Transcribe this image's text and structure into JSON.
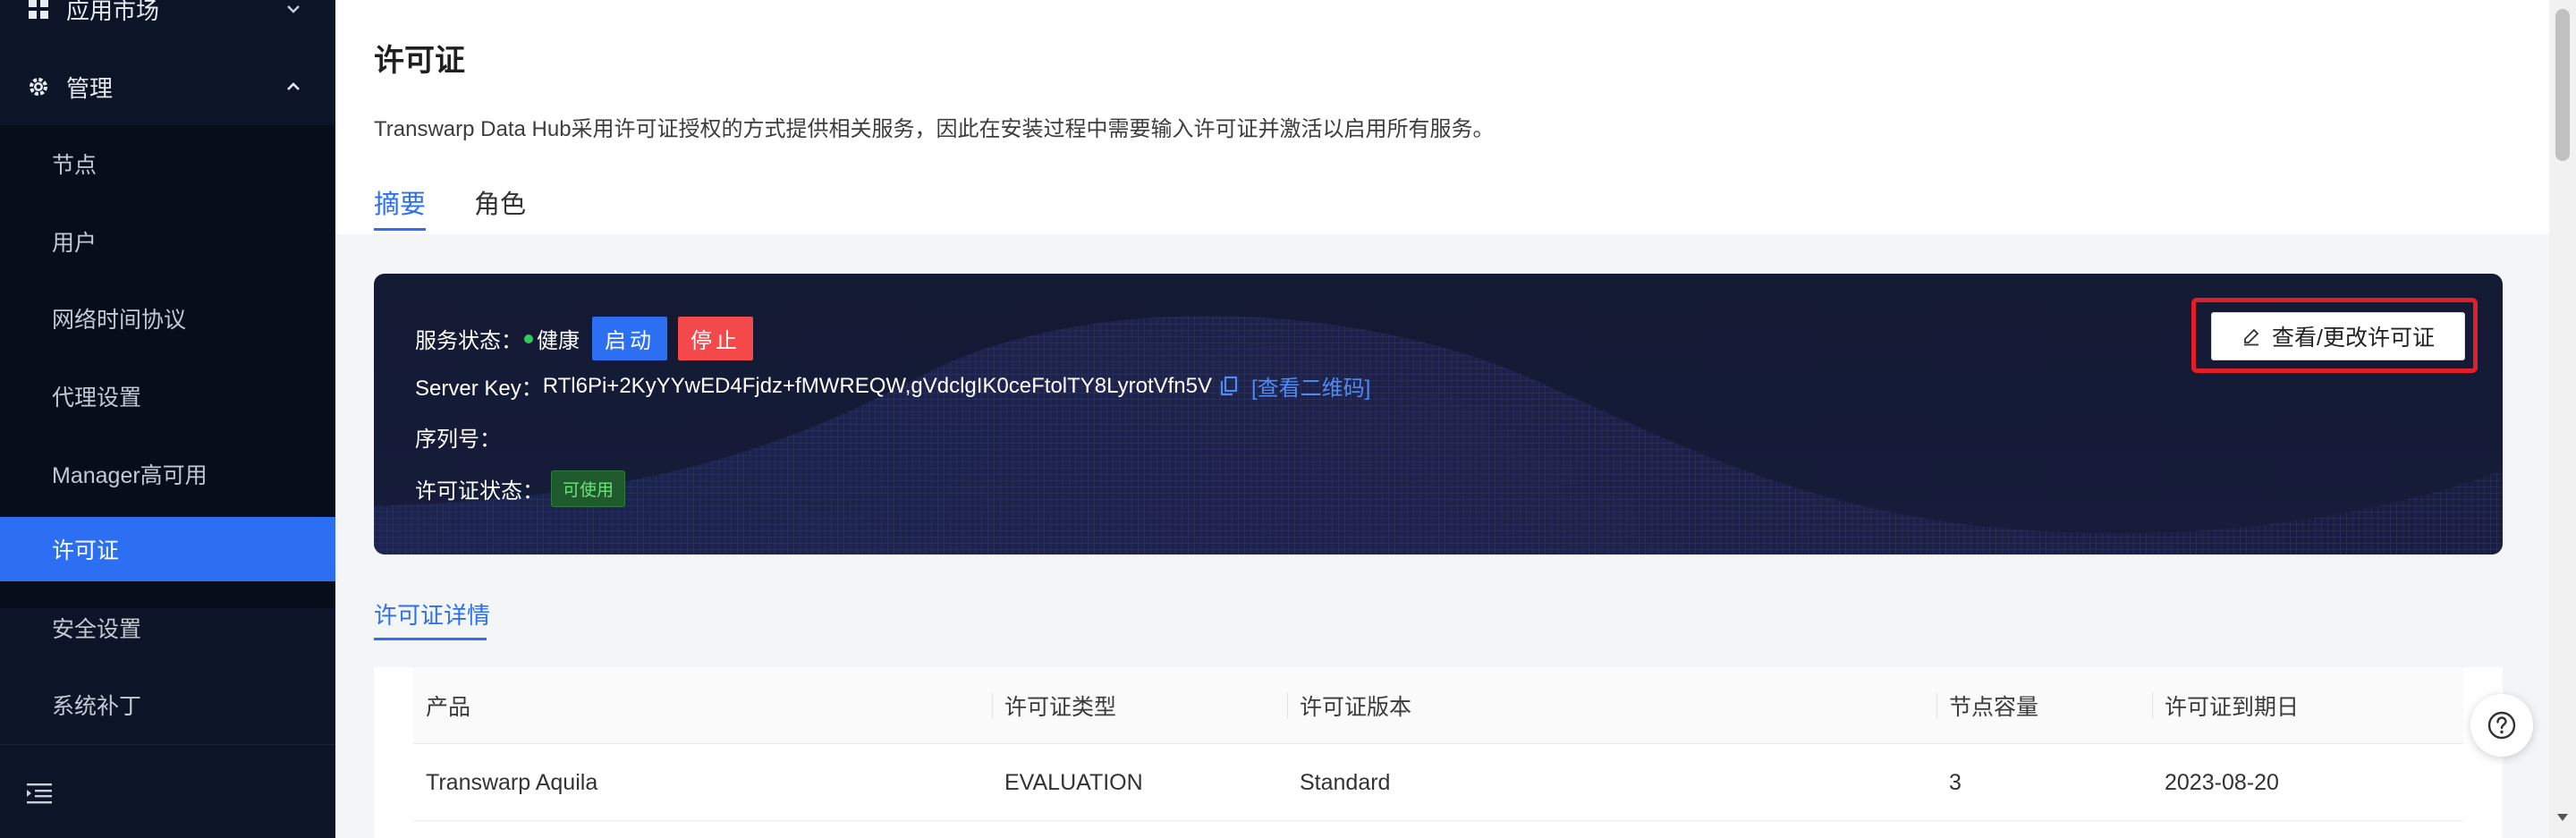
{
  "sidebar": {
    "app_market_label": "应用市场",
    "manage_label": "管理",
    "items": [
      {
        "label": "节点"
      },
      {
        "label": "用户"
      },
      {
        "label": "网络时间协议"
      },
      {
        "label": "代理设置"
      },
      {
        "label": "Manager高可用"
      },
      {
        "label": "许可证",
        "active": true
      },
      {
        "label": "安全设置"
      },
      {
        "label": "系统补丁"
      }
    ]
  },
  "main": {
    "title": "许可证",
    "description": "Transwarp Data Hub采用许可证授权的方式提供相关服务，因此在安装过程中需要输入许可证并激活以启用所有服务。",
    "tabs": [
      {
        "label": "摘要",
        "active": true
      },
      {
        "label": "角色"
      }
    ],
    "card": {
      "service_status_label": "服务状态：",
      "service_status_value": "健康",
      "start_label": "启动",
      "stop_label": "停止",
      "server_key_label": "Server Key：",
      "server_key_value": "RTl6Pi+2KyYYwED4Fjdz+fMWREQW,gVdclgIK0ceFtolTY8LyrotVfn5V",
      "qr_link": "[查看二维码]",
      "serial_label": "序列号：",
      "license_status_label": "许可证状态：",
      "license_status_badge": "可使用",
      "view_change_license": "查看/更改许可证"
    },
    "detail_tab": "许可证详情",
    "table": {
      "headers": [
        "产品",
        "许可证类型",
        "许可证版本",
        "节点容量",
        "许可证到期日"
      ],
      "rows": [
        [
          "Transwarp Aquila",
          "EVALUATION",
          "Standard",
          "3",
          "2023-08-20"
        ]
      ]
    }
  },
  "colors": {
    "sidebar_bg": "#0b1527",
    "active_item": "#2d6ff2",
    "start_button": "#2d6ff2",
    "stop_button": "#f4494a",
    "highlight": "#e41e26"
  },
  "icons": {
    "app_market": "grid-icon",
    "manage": "gear-icon",
    "collapse": "menu-collapse-icon",
    "copy": "copy-icon",
    "edit": "pen-icon",
    "help": "question-icon"
  }
}
